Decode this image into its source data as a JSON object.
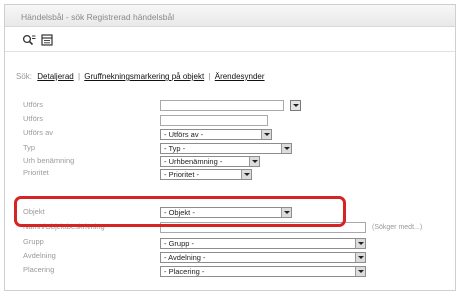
{
  "window": {
    "title": "Händelsbål - sök Registrerad händelsbål"
  },
  "toolbar": {
    "search_icon": "search-filter-icon",
    "list_icon": "table-list-icon"
  },
  "breadcrumb": {
    "prefix": "Sök:",
    "links": [
      "Detaljerad",
      "Gruffnekningsmarkering på objekt",
      "Ärendesynder"
    ],
    "separator": "|"
  },
  "form": {
    "fields": [
      {
        "label": "Utförs",
        "value": ""
      },
      {
        "label": "Utförs",
        "value": ""
      },
      {
        "label": "Utförs av",
        "value": "- Utförs av -"
      },
      {
        "label": "Typ",
        "value": "- Typ -"
      },
      {
        "label": "Urh benämning",
        "value": "- Urhbenämning -"
      },
      {
        "label": "Prioritet",
        "value": "- Prioritet -"
      },
      {
        "label": "Objekt",
        "value": "- Objekt -"
      },
      {
        "label": "Namn/Objektbeskrivning",
        "value": ""
      },
      {
        "label": "Grupp",
        "value": "- Grupp -"
      },
      {
        "label": "Avdelning",
        "value": "- Avdelning -"
      },
      {
        "label": "Placering",
        "value": "- Placering -"
      }
    ],
    "search_button": "(Sökger medt...)"
  }
}
